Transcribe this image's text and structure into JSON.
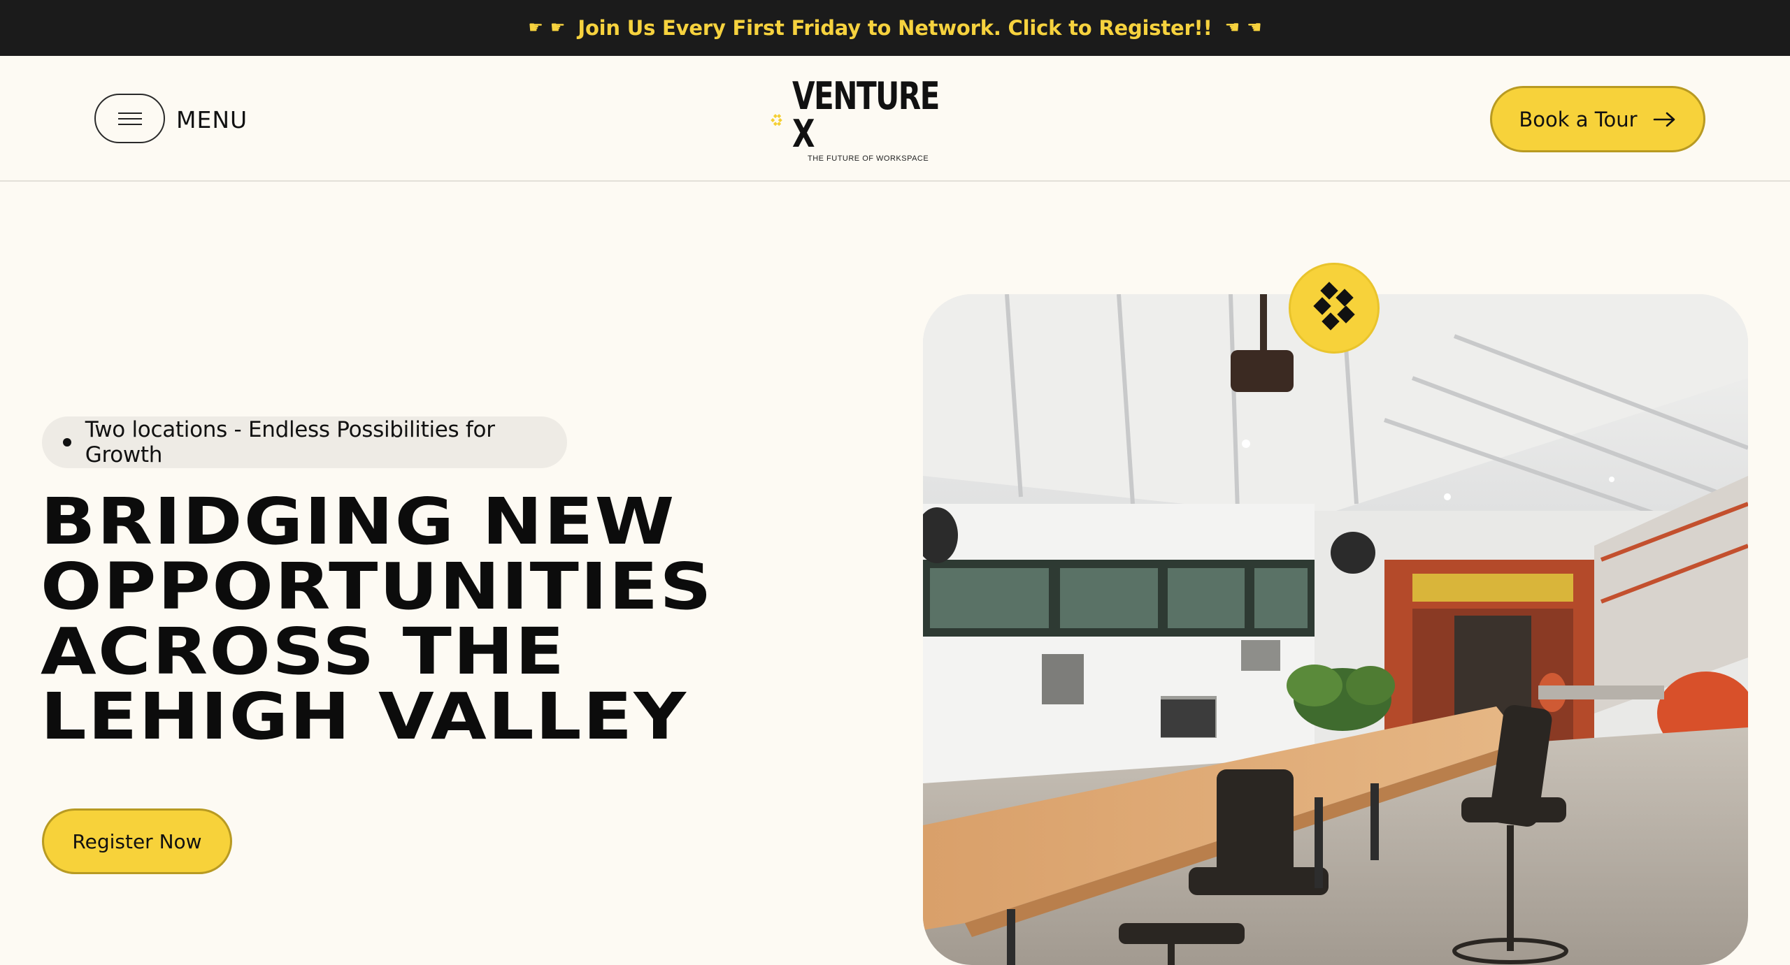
{
  "announcement": {
    "text": "Join Us Every First Friday to Network. Click to Register!!",
    "left_icon": "pointing-right-hand-icon",
    "right_icon": "pointing-left-hand-icon"
  },
  "header": {
    "menu_label": "MENU",
    "logo_name": "VENTURE X",
    "logo_tagline": "THE FUTURE OF WORKSPACE",
    "cta_label": "Book a Tour"
  },
  "hero": {
    "pill_text": "Two locations - Endless Possibilities for Growth",
    "headline_lines": [
      "BRIDGING NEW",
      "OPPORTUNITIES",
      "ACROSS THE",
      "LEHIGH VALLEY"
    ],
    "register_label": "Register Now"
  },
  "colors": {
    "accent": "#f7d23a",
    "announcement_bg": "#1b1b1b",
    "page_bg": "#fdfaf3"
  }
}
